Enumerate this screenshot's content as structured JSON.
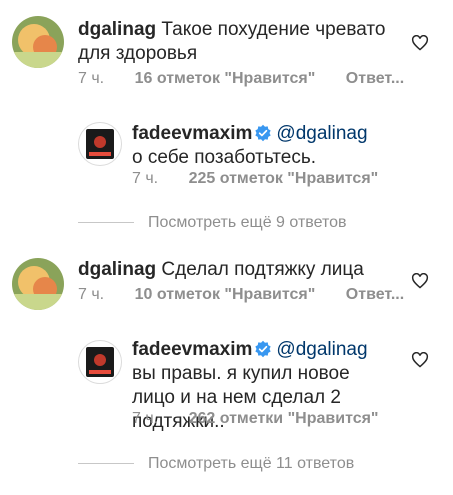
{
  "comments": [
    {
      "username": "dgalinag",
      "text": "Такое похудение чревато для здоровья",
      "time": "7 ч.",
      "likes": "16 отметок \"Нравится\"",
      "reply": "Ответ...",
      "replies": [
        {
          "username": "fadeevmaxim",
          "mention": "@dgalinag",
          "text": "о себе позаботьтесь.",
          "time": "7 ч.",
          "likes": "225 отметок \"Нравится\""
        }
      ],
      "view_more": "Посмотреть ещё 9 ответов"
    },
    {
      "username": "dgalinag",
      "text": "Сделал подтяжку лица",
      "time": "7 ч.",
      "likes": "10 отметок \"Нравится\"",
      "reply": "Ответ...",
      "replies": [
        {
          "username": "fadeevmaxim",
          "mention": "@dgalinag",
          "text": "вы правы. я купил новое лицо и на нем сделал 2 подтяжки..",
          "time": "7 ч.",
          "likes": "262 отметки \"Нравится\""
        }
      ],
      "view_more": "Посмотреть ещё 11 ответов"
    }
  ],
  "icons": {
    "like": "heart-outline-icon",
    "verified": "verified-badge-icon",
    "avatar_main": "avatar-photo",
    "avatar_reply": "avatar-photo"
  },
  "colors": {
    "text": "#262626",
    "meta": "#8e8e8e",
    "mention": "#00376b",
    "verified": "#3897f0"
  }
}
